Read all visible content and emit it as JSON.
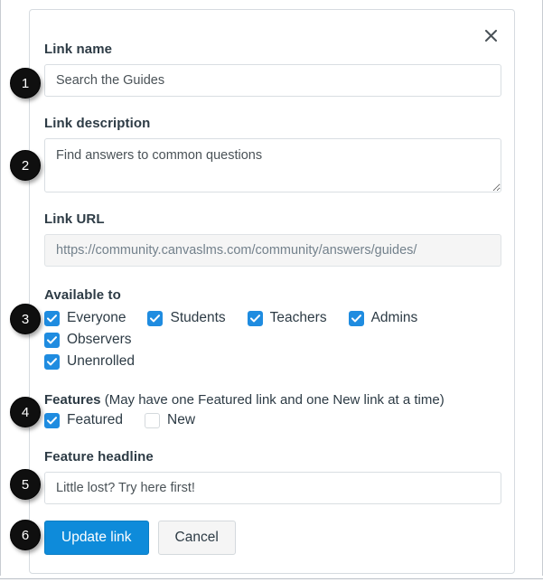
{
  "dialog": {
    "close_icon": "close-icon",
    "fields": {
      "link_name": {
        "label": "Link name",
        "value": "Search the Guides",
        "placeholder": "Link name"
      },
      "link_description": {
        "label": "Link description",
        "value": "Find answers to common questions",
        "placeholder": "Link description"
      },
      "link_url": {
        "label": "Link URL",
        "value": "https://community.canvaslms.com/community/answers/guides/",
        "placeholder": "Link URL"
      },
      "feature_headline": {
        "label": "Feature headline",
        "value": "Little lost? Try here first!",
        "placeholder": "Feature headline"
      }
    },
    "available_to": {
      "label": "Available to",
      "options": [
        {
          "label": "Everyone",
          "checked": true
        },
        {
          "label": "Students",
          "checked": true
        },
        {
          "label": "Teachers",
          "checked": true
        },
        {
          "label": "Admins",
          "checked": true
        },
        {
          "label": "Observers",
          "checked": true
        },
        {
          "label": "Unenrolled",
          "checked": true
        }
      ]
    },
    "features": {
      "label": "Features",
      "note": " (May have one Featured link and one New link at a time)",
      "options": [
        {
          "label": "Featured",
          "checked": true
        },
        {
          "label": "New",
          "checked": false
        }
      ]
    },
    "buttons": {
      "submit": "Update link",
      "cancel": "Cancel"
    }
  },
  "callouts": [
    {
      "number": "1"
    },
    {
      "number": "2"
    },
    {
      "number": "3"
    },
    {
      "number": "4"
    },
    {
      "number": "5"
    },
    {
      "number": "6"
    }
  ],
  "colors": {
    "primary_blue": "#0e8bda",
    "checkbox_blue": "#1f8ce0",
    "text": "#2d3b45",
    "muted_text": "#73818c",
    "border": "#d9dee2",
    "badge": "#0f0f0f"
  }
}
